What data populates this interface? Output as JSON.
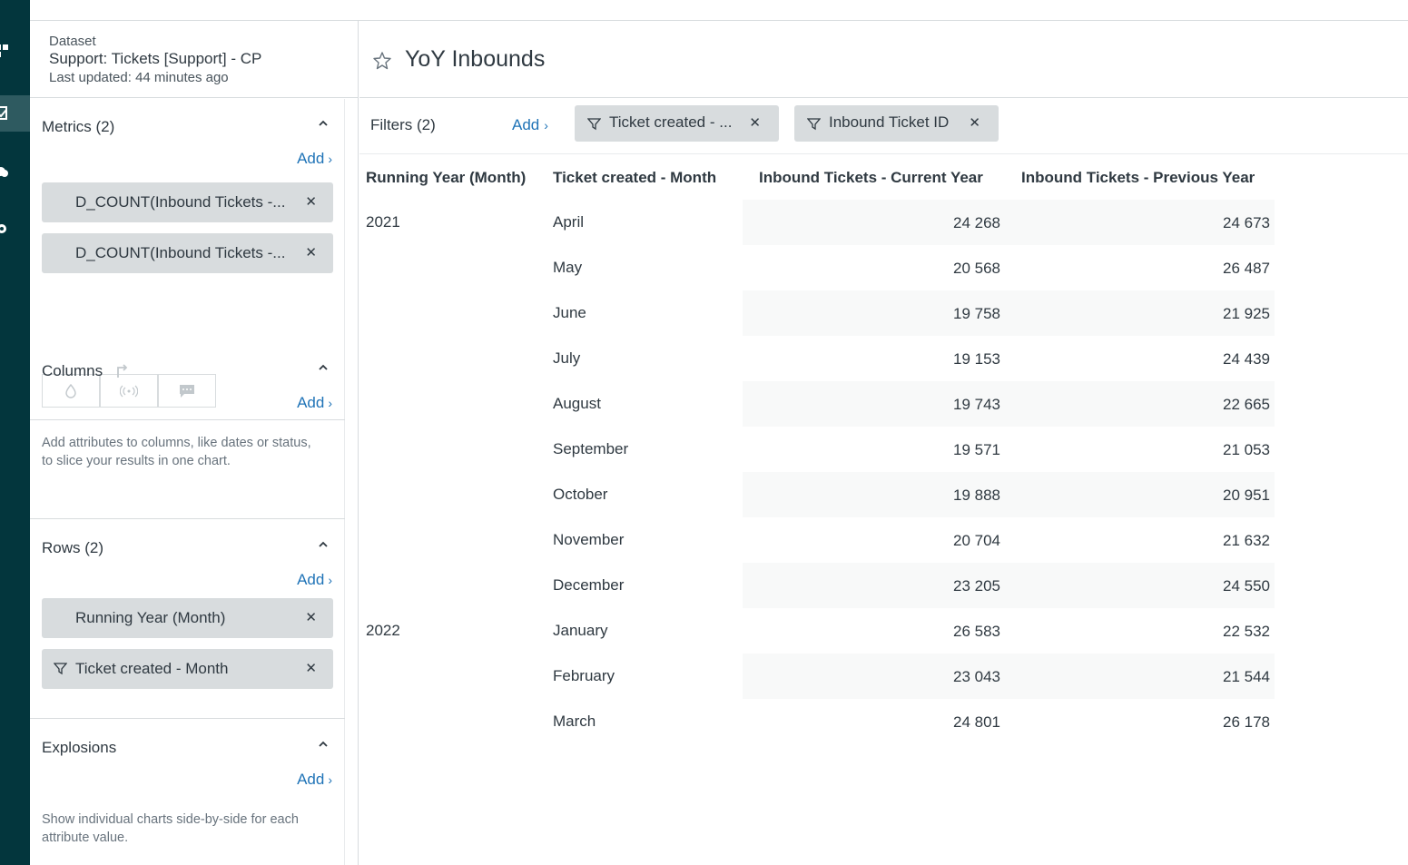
{
  "dataset": {
    "label": "Dataset",
    "name": "Support: Tickets [Support] - CP",
    "updated": "Last updated: 44 minutes ago"
  },
  "panel": {
    "metrics": {
      "title": "Metrics (2)",
      "add": "Add",
      "items": [
        "D_COUNT(Inbound Tickets -...",
        "D_COUNT(Inbound Tickets -..."
      ]
    },
    "columns": {
      "title": "Columns",
      "add": "Add",
      "help": "Add attributes to columns, like dates or status, to slice your results in one chart."
    },
    "rows": {
      "title": "Rows (2)",
      "add": "Add",
      "items": [
        "Running Year (Month)",
        "Ticket created - Month"
      ]
    },
    "explosions": {
      "title": "Explosions",
      "add": "Add",
      "help": "Show individual charts side-by-side for each attribute value."
    }
  },
  "report": {
    "title": "YoY Inbounds",
    "filters_label": "Filters (2)",
    "filters_add": "Add",
    "filters": [
      "Ticket created - ...",
      "Inbound Ticket ID"
    ]
  },
  "table": {
    "headers": [
      "Running Year (Month)",
      "Ticket created - Month",
      "Inbound Tickets - Current Year",
      "Inbound Tickets - Previous Year"
    ],
    "rows": [
      {
        "year": "2021",
        "month": "April",
        "current": "24 268",
        "previous": "24 673"
      },
      {
        "year": "",
        "month": "May",
        "current": "20 568",
        "previous": "26 487"
      },
      {
        "year": "",
        "month": "June",
        "current": "19 758",
        "previous": "21 925"
      },
      {
        "year": "",
        "month": "July",
        "current": "19 153",
        "previous": "24 439"
      },
      {
        "year": "",
        "month": "August",
        "current": "19 743",
        "previous": "22 665"
      },
      {
        "year": "",
        "month": "September",
        "current": "19 571",
        "previous": "21 053"
      },
      {
        "year": "",
        "month": "October",
        "current": "19 888",
        "previous": "20 951"
      },
      {
        "year": "",
        "month": "November",
        "current": "20 704",
        "previous": "21 632"
      },
      {
        "year": "",
        "month": "December",
        "current": "23 205",
        "previous": "24 550"
      },
      {
        "year": "2022",
        "month": "January",
        "current": "26 583",
        "previous": "22 532"
      },
      {
        "year": "",
        "month": "February",
        "current": "23 043",
        "previous": "21 544"
      },
      {
        "year": "",
        "month": "March",
        "current": "24 801",
        "previous": "26 178"
      }
    ]
  },
  "colors": {
    "rail": "#03363d",
    "link": "#1f73b7",
    "chip": "#d8dcde"
  }
}
